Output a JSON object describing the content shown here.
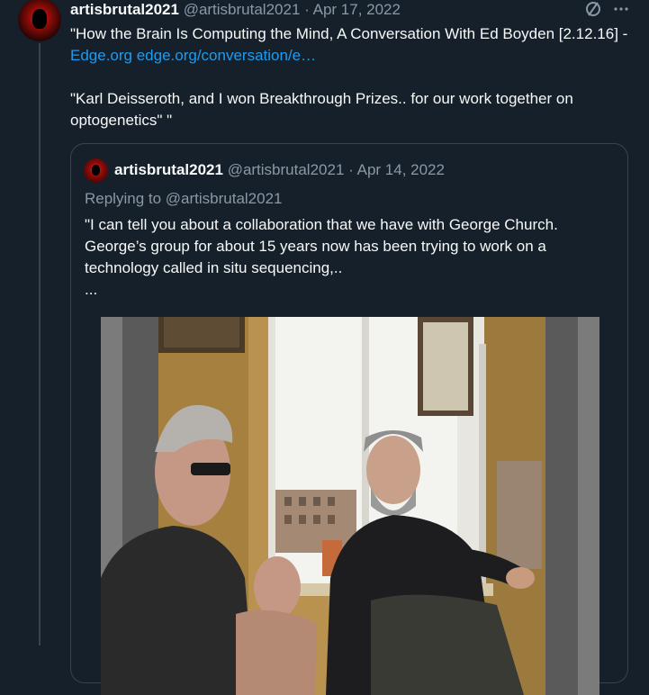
{
  "tweet": {
    "author_name": "artisbrutal2021",
    "handle": "@artisbrutal2021",
    "separator": "·",
    "date": "Apr 17, 2022",
    "text_line1": "\"How the Brain Is Computing the Mind, A Conversation With Ed Boyden [2.12.16] - ",
    "link_text": "Edge.org edge.org/conversation/e…",
    "text_line2": "\"Karl Deisseroth, and I won Breakthrough Prizes.. for our work together on optogenetics\" \""
  },
  "quote": {
    "author_name": "artisbrutal2021",
    "handle": "@artisbrutal2021",
    "separator": "·",
    "date": "Apr 14, 2022",
    "replying_to": "Replying to @artisbrutal2021",
    "text_line1": "\"I can tell you about a collaboration that we have with George Church.",
    "text_line2": "George’s group for about 15 years now has been trying to work on a",
    "text_line3": "technology called in situ sequencing,..",
    "text_line4": "..."
  },
  "icons": {
    "grok": "slash-circle-icon",
    "more": "more-dots-icon"
  },
  "colors": {
    "background": "#15202b",
    "link": "#1d9bf0",
    "muted": "#8b98a5",
    "border": "#38444d"
  }
}
